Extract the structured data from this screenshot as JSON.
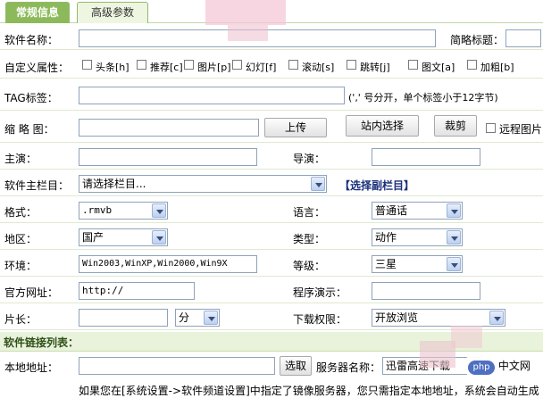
{
  "tabs": [
    {
      "label": "常规信息"
    },
    {
      "label": "高级参数"
    }
  ],
  "fields": {
    "name_label": "软件名称：",
    "short_title_label": "简略标题：",
    "custom_attr_label": "自定义属性：",
    "attrs": [
      "头条[h]",
      "推荐[c]",
      "图片[p]",
      "幻灯[f]",
      "滚动[s]",
      "跳转[j]",
      "图文[a]",
      "加粗[b]"
    ],
    "tag_label": "TAG标签：",
    "tag_hint": "(',' 号分开，单个标签小于12字节)",
    "thumb_label": "缩 略 图：",
    "upload_btn": "上传",
    "site_select_btn": "站内选择",
    "crop_btn": "裁剪",
    "remote_img": "远程图片",
    "starring_label": "主演：",
    "director_label": "导演：",
    "main_column_label": "软件主栏目：",
    "main_column_value": "请选择栏目...",
    "sub_column_link": "【选择副栏目】",
    "format_label": "格式：",
    "format_value": ".rmvb",
    "language_label": "语言：",
    "language_value": "普通话",
    "region_label": "地区：",
    "region_value": "国产",
    "type_label": "类型：",
    "type_value": "动作",
    "env_label": "环境：",
    "env_value": "Win2003,WinXP,Win2000,Win9X",
    "level_label": "等级：",
    "level_value": "三星",
    "site_label": "官方网址：",
    "site_value": "http://",
    "demo_label": "程序演示：",
    "length_label": "片长：",
    "length_unit": "分",
    "permission_label": "下载权限：",
    "permission_value": "开放浏览"
  },
  "links_section": {
    "title": "软件链接列表：",
    "local_label": "本地地址：",
    "browse_btn": "选取",
    "server_label": "服务器名称：",
    "server_value": "迅雷高速下载",
    "note": "如果您在[系统设置->软件频道设置]中指定了镜像服务器，您只需指定本地地址，系统会自动生成"
  },
  "watermark": {
    "badge": "php",
    "text": "中文网"
  }
}
